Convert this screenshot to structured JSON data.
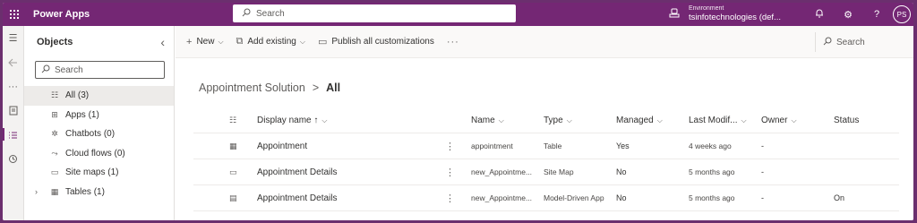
{
  "topbar": {
    "app_title": "Power Apps",
    "search_placeholder": "Search",
    "env_label": "Environment",
    "env_name": "tsinfotechnologies (def...",
    "avatar_initials": "PS",
    "brand_color": "#742774"
  },
  "rail": {
    "items": [
      "hamburger-icon",
      "back-icon",
      "more-icon",
      "page-icon",
      "list-icon",
      "history-icon"
    ]
  },
  "objects": {
    "title": "Objects",
    "search_placeholder": "Search",
    "items": [
      {
        "label": "All",
        "count": "(3)",
        "icon": "list-icon"
      },
      {
        "label": "Apps",
        "count": "(1)",
        "icon": "apps-icon"
      },
      {
        "label": "Chatbots",
        "count": "(0)",
        "icon": "chatbot-icon"
      },
      {
        "label": "Cloud flows",
        "count": "(0)",
        "icon": "flow-icon"
      },
      {
        "label": "Site maps",
        "count": "(1)",
        "icon": "sitemap-icon"
      },
      {
        "label": "Tables",
        "count": "(1)",
        "icon": "table-icon"
      }
    ]
  },
  "commandbar": {
    "new_label": "New",
    "add_existing_label": "Add existing",
    "publish_label": "Publish all customizations",
    "more_label": "···",
    "search_label": "Search"
  },
  "breadcrumb": {
    "parent": "Appointment Solution",
    "separator": ">",
    "current": "All"
  },
  "table": {
    "headers": {
      "display_name": "Display name ↑",
      "name": "Name",
      "type": "Type",
      "managed": "Managed",
      "last_modified": "Last Modif...",
      "owner": "Owner",
      "status": "Status"
    },
    "rows": [
      {
        "icon": "table-icon",
        "display_name": "Appointment",
        "name": "appointment",
        "type": "Table",
        "managed": "Yes",
        "last_modified": "4 weeks ago",
        "owner": "-",
        "status": ""
      },
      {
        "icon": "sitemap-icon",
        "display_name": "Appointment Details",
        "name": "new_Appointme...",
        "type": "Site Map",
        "managed": "No",
        "last_modified": "5 months ago",
        "owner": "-",
        "status": ""
      },
      {
        "icon": "app-icon",
        "display_name": "Appointment Details",
        "name": "new_Appointme...",
        "type": "Model-Driven App",
        "managed": "No",
        "last_modified": "5 months ago",
        "owner": "-",
        "status": "On"
      }
    ]
  }
}
